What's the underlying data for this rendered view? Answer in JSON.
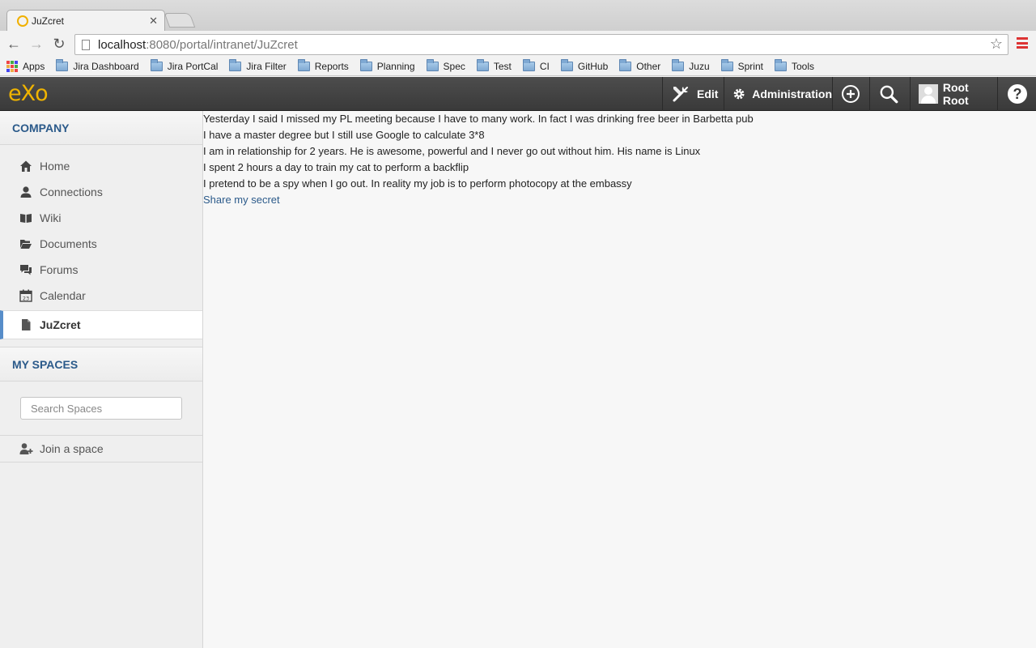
{
  "browser": {
    "tab_title": "JuZcret",
    "url_host": "localhost",
    "url_rest": ":8080/portal/intranet/JuZcret",
    "bookmarks": [
      "Apps",
      "Jira Dashboard",
      "Jira PortCal",
      "Jira Filter",
      "Reports",
      "Planning",
      "Spec",
      "Test",
      "CI",
      "GitHub",
      "Other",
      "Juzu",
      "Sprint",
      "Tools"
    ]
  },
  "topbar": {
    "logo": "eXo",
    "edit_label": "Edit",
    "admin_label": "Administration",
    "user_name": "Root Root",
    "help_label": "?"
  },
  "sidebar": {
    "company_title": "COMPANY",
    "items": [
      {
        "label": "Home",
        "icon": "home-icon"
      },
      {
        "label": "Connections",
        "icon": "user-icon"
      },
      {
        "label": "Wiki",
        "icon": "book-icon"
      },
      {
        "label": "Documents",
        "icon": "folder-open-icon"
      },
      {
        "label": "Forums",
        "icon": "chat-icon"
      },
      {
        "label": "Calendar",
        "icon": "calendar-icon"
      },
      {
        "label": "JuZcret",
        "icon": "page-icon"
      }
    ],
    "calendar_day": "23",
    "spaces_title": "MY SPACES",
    "search_placeholder": "Search Spaces",
    "join_label": "Join a space"
  },
  "main": {
    "secrets": [
      "Yesterday I said I missed my PL meeting because I have to many work. In fact I was drinking free beer in Barbetta pub",
      "I have a master degree but I still use Google to calculate 3*8",
      "I am in relationship for 2 years. He is awesome, powerful and I never go out without him. His name is Linux",
      "I spent 2 hours a day to train my cat to perform a backflip",
      "I pretend to be a spy when I go out. In reality my job is to perform photocopy at the embassy"
    ],
    "share_label": "Share my secret"
  }
}
